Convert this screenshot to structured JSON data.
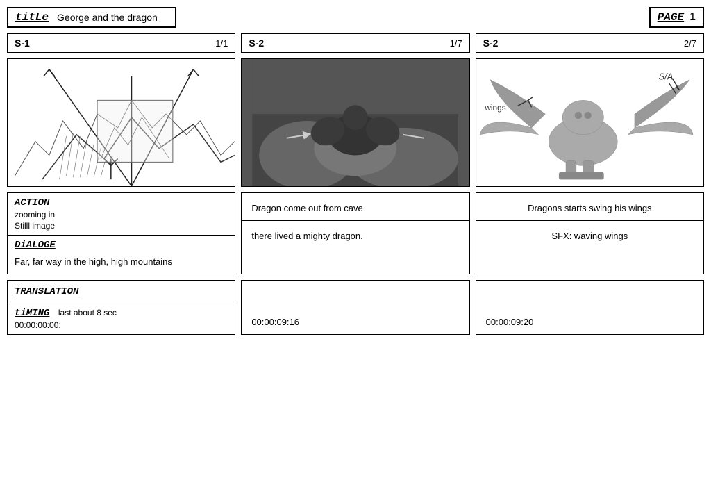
{
  "header": {
    "title_label": "titLe",
    "title_value": "George and the dragon",
    "page_label": "PAGE",
    "page_number": "1"
  },
  "scenes": [
    {
      "id": "S-1",
      "page": "1/1",
      "action_label": "ACTION",
      "action_text": "zooming in",
      "action_subtext": "Stilll image",
      "dialogue_label": "DiALOGE",
      "dialogue_text": "Far, far way in the high, high mountains",
      "translation_label": "TRANSLATION",
      "timing_label": "tiMING",
      "timing_value": "last about 8 sec",
      "timecode": "00:00:00:00:"
    },
    {
      "id": "S-2",
      "page": "1/7",
      "action_text": "Dragon come out from cave",
      "dialogue_text": "there lived a mighty dragon.",
      "timecode": "00:00:09:16"
    },
    {
      "id": "S-2",
      "page": "2/7",
      "action_text": "Dragons starts swing his wings",
      "sfx_text": "SFX:   waving wings",
      "timecode": "00:00:09:20"
    }
  ]
}
